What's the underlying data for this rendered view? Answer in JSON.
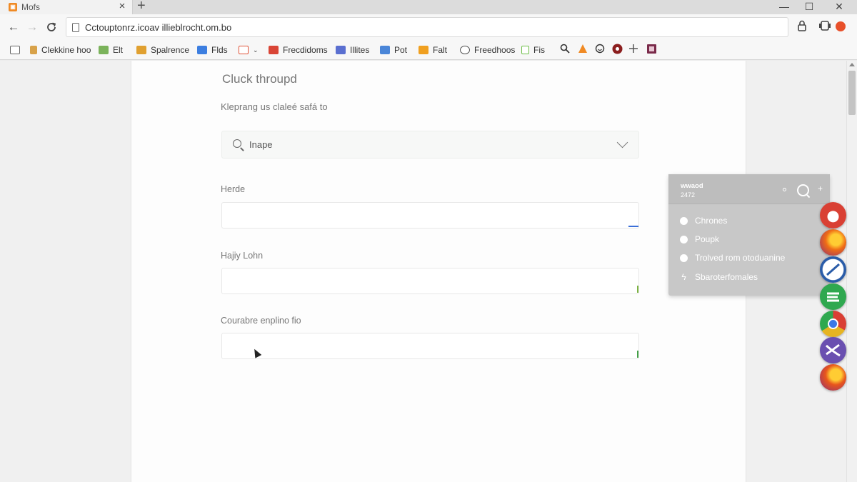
{
  "tab": {
    "title": "Mofs",
    "close": "×",
    "new_tab": "+"
  },
  "window": {
    "minimize": "—",
    "maximize": "☐",
    "close": "✕"
  },
  "toolbar": {
    "back": "←",
    "forward": "→",
    "reload": "C",
    "url": "Cctouptonrz.icoav illieblrocht.om.bo",
    "account": "⍝",
    "extension": "⧉"
  },
  "bookmarks": [
    {
      "label": "Clekkine hoo",
      "color": "#d8a24a"
    },
    {
      "label": "Elt",
      "color": "#7bb35b"
    },
    {
      "label": "Spalrence",
      "color": "#e0a030"
    },
    {
      "label": "Flds",
      "color": "#3c7ee0"
    },
    {
      "label": "",
      "color": "#e0553a"
    },
    {
      "label": "Frecdidoms",
      "color": "#d94536"
    },
    {
      "label": "Illites",
      "color": "#5a6fd0"
    },
    {
      "label": "Pot",
      "color": "#4a86d8"
    },
    {
      "label": "Falt",
      "color": "#f0a020"
    },
    {
      "label": "Freedhoos",
      "color": "#555555"
    },
    {
      "label": "Fis",
      "color": "#6fbf4a"
    }
  ],
  "bookmark_tools": [
    "search",
    "warning",
    "smile",
    "record",
    "plus",
    "book"
  ],
  "form": {
    "heading": "Cluck throupd",
    "subheading": "Kleprang us claleé safá to",
    "select_value": "Inape",
    "fields": [
      {
        "label": "Herde",
        "value": "",
        "mark_color": "#3b6fd8"
      },
      {
        "label": "Hajiy Lohn",
        "value": "",
        "mark_color": "#7cb342"
      },
      {
        "label": "Courabre enplino fio",
        "value": "",
        "mark_color": "#43a047"
      }
    ]
  },
  "popup": {
    "title": "wwaod",
    "subtitle": "2472",
    "options": [
      {
        "label": "Chrones",
        "marker": "radio"
      },
      {
        "label": "Poupk",
        "marker": "radio"
      },
      {
        "label": "Trolved rom otoduanine",
        "marker": "radio"
      },
      {
        "label": "Sbaroterfomales",
        "marker": "bolt"
      }
    ]
  },
  "dock": [
    {
      "name": "opera-mini-icon",
      "color": "#d94034"
    },
    {
      "name": "firefox-icon",
      "color": "#ef6c16"
    },
    {
      "name": "safari-icon",
      "color": "#2a5ca8"
    },
    {
      "name": "edge-icon",
      "color": "#2fa84f"
    },
    {
      "name": "chrome-icon",
      "color": "#e6b422"
    },
    {
      "name": "tor-icon",
      "color": "#6a4fb0"
    },
    {
      "name": "firefox-alt-icon",
      "color": "#e8561c"
    }
  ]
}
